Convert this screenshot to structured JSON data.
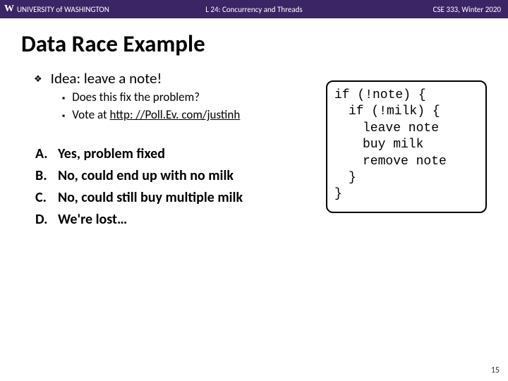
{
  "header": {
    "logo_w": "W",
    "logo_text": "UNIVERSITY of WASHINGTON",
    "lecture": "L 24:  Concurrency and Threads",
    "course": "CSE 333, Winter 2020"
  },
  "title": "Data Race Example",
  "idea": {
    "text": "Idea: leave a note!",
    "sub": [
      "Does this fix the problem?",
      "Vote at "
    ],
    "link": "http: //Poll.Ev. com/justinh"
  },
  "answers": [
    {
      "letter": "A.",
      "text": "Yes, problem fixed"
    },
    {
      "letter": "B.",
      "text": "No, could end up with no milk"
    },
    {
      "letter": "C.",
      "text": "No, could still buy multiple milk"
    },
    {
      "letter": "D.",
      "text": "We're lost…"
    }
  ],
  "code": {
    "l1": "if (!note) {",
    "l2": "if (!milk) {",
    "l3": "leave note",
    "l4": "buy milk",
    "l5": "remove note",
    "l6": "}",
    "l7": "}"
  },
  "page": "15"
}
